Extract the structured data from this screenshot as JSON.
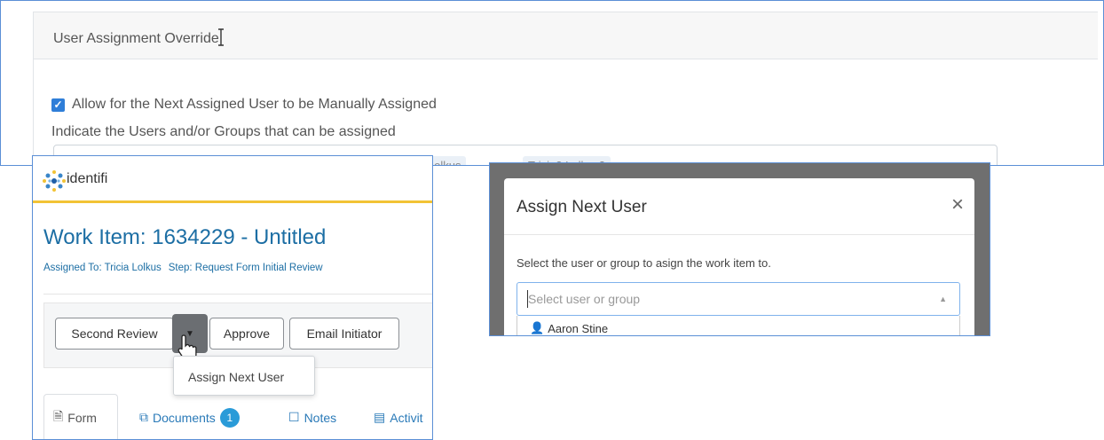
{
  "settings": {
    "header_title": "User Assignment Override",
    "checkbox_label": "Allow for the Next Assigned User to be Manually Assigned",
    "checkbox_checked": true,
    "indicate_label": "Indicate the Users and/or Groups that can be assigned",
    "chips": [
      "Tricia Lolkus",
      "Tricia2 Lolkus2"
    ]
  },
  "workitem": {
    "logo_text": "identifi",
    "title": "Work Item: 1634229 - Untitled",
    "assigned_to": "Assigned To: Tricia Lolkus",
    "step": "Step: Request Form Initial Review",
    "buttons": {
      "second_review": "Second Review",
      "approve": "Approve",
      "email_initiator": "Email Initiator"
    },
    "dropdown_item": "Assign Next User",
    "tabs": {
      "form": "Form",
      "documents": "Documents",
      "documents_count": "1",
      "notes": "Notes",
      "activity": "Activit"
    }
  },
  "modal": {
    "title": "Assign Next User",
    "close": "×",
    "instruction": "Select the user or group to asign the work item to.",
    "select_placeholder": "Select user or group",
    "options": [
      "Aaron Stine"
    ]
  },
  "colors": {
    "accent_blue": "#2f7ed8",
    "title_blue": "#1c6ea4",
    "brand_yellow": "#f2c335",
    "badge_blue": "#2a9bd8"
  }
}
